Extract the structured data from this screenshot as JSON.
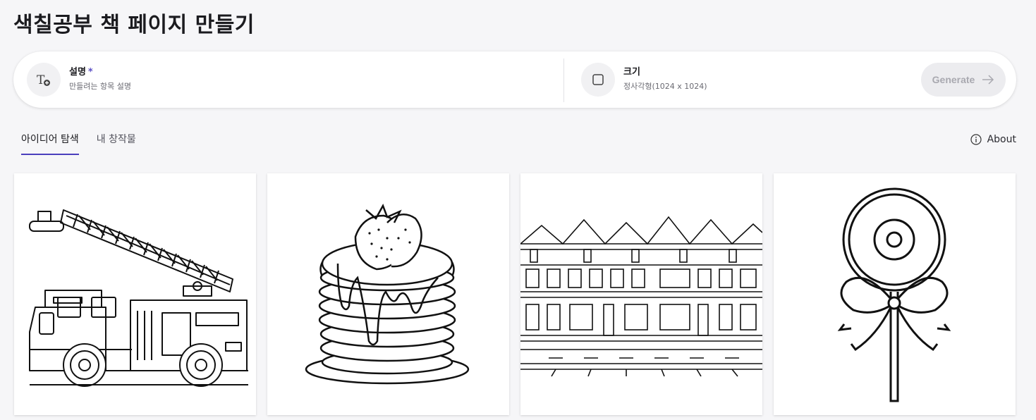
{
  "page": {
    "title": "색칠공부 책 페이지 만들기"
  },
  "prompt": {
    "description": {
      "label": "설명",
      "required_mark": "*",
      "placeholder": "만들려는 항목 설명",
      "icon": "text-add-icon"
    },
    "size": {
      "label": "크기",
      "value": "정사각형(1024 x 1024)",
      "icon": "square-icon"
    },
    "generate_label": "Generate",
    "generate_enabled": false
  },
  "tabs": [
    {
      "label": "아이디어 탐색",
      "active": true
    },
    {
      "label": "내 창작물",
      "active": false
    }
  ],
  "about_label": "About",
  "gallery": [
    {
      "subject": "fire truck coloring page"
    },
    {
      "subject": "pancake stack with strawberries coloring page"
    },
    {
      "subject": "row of victorian houses coloring page"
    },
    {
      "subject": "lollipop with bow coloring page"
    }
  ],
  "colors": {
    "accent": "#4b3fbd",
    "required": "#5b4fc4",
    "background": "#f6f6f8"
  }
}
